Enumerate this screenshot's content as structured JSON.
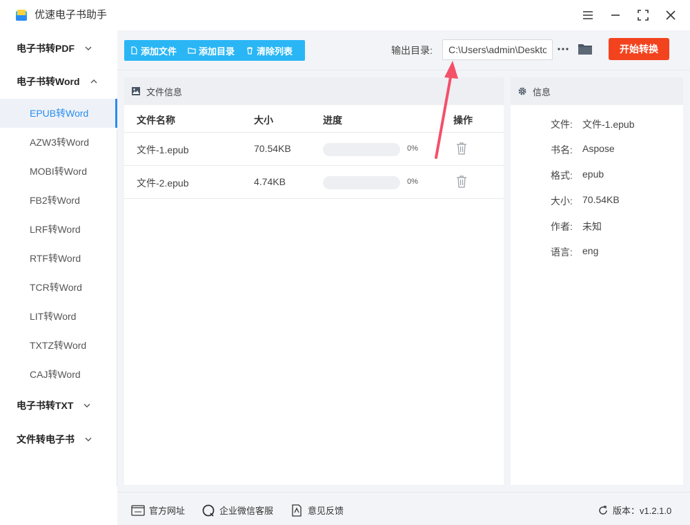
{
  "app": {
    "title": "优速电子书助手"
  },
  "sidebar": {
    "categories": [
      {
        "label": "电子书转PDF",
        "expanded": false
      },
      {
        "label": "电子书转Word",
        "expanded": true
      },
      {
        "label": "电子书转TXT",
        "expanded": false
      },
      {
        "label": "文件转电子书",
        "expanded": false
      }
    ],
    "word_items": [
      {
        "label": "EPUB转Word",
        "active": true
      },
      {
        "label": "AZW3转Word"
      },
      {
        "label": "MOBI转Word"
      },
      {
        "label": "FB2转Word"
      },
      {
        "label": "LRF转Word"
      },
      {
        "label": "RTF转Word"
      },
      {
        "label": "TCR转Word"
      },
      {
        "label": "LIT转Word"
      },
      {
        "label": "TXTZ转Word"
      },
      {
        "label": "CAJ转Word"
      }
    ]
  },
  "toolbar": {
    "add_file": "添加文件",
    "add_dir": "添加目录",
    "clear_list": "清除列表",
    "output_label": "输出目录:",
    "output_value": "C:\\Users\\admin\\Desktop",
    "more": "···",
    "start": "开始转换"
  },
  "file_panel": {
    "title": "文件信息",
    "columns": [
      "文件名称",
      "大小",
      "进度",
      "操作"
    ],
    "rows": [
      {
        "name": "文件-1.epub",
        "size": "70.54KB",
        "progress": 0,
        "progress_text": "0%"
      },
      {
        "name": "文件-2.epub",
        "size": "4.74KB",
        "progress": 0,
        "progress_text": "0%"
      }
    ]
  },
  "info_panel": {
    "title": "信息",
    "fields": [
      {
        "key": "文件:",
        "value": "文件-1.epub"
      },
      {
        "key": "书名:",
        "value": "Aspose"
      },
      {
        "key": "格式:",
        "value": "epub"
      },
      {
        "key": "大小:",
        "value": "70.54KB"
      },
      {
        "key": "作者:",
        "value": "未知"
      },
      {
        "key": "语言:",
        "value": "eng"
      }
    ]
  },
  "footer": {
    "website": "官方网址",
    "wechat": "企业微信客服",
    "feedback": "意见反馈",
    "version": "版本：v1.2.1.0"
  },
  "colors": {
    "accent": "#2a8cf0",
    "toolbar_buttons": "#2ab6f5",
    "start_button": "#f2431e",
    "annotation_arrow": "#f4506a"
  }
}
